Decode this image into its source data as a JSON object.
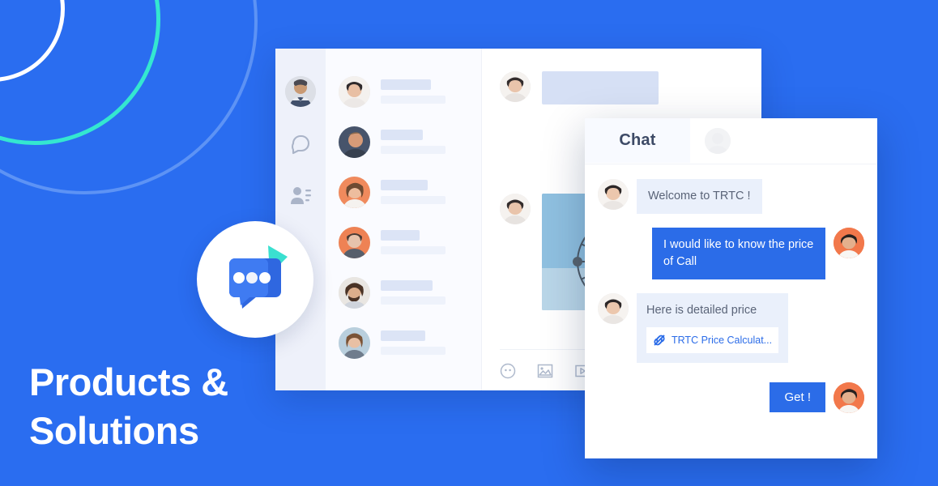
{
  "page": {
    "background_color": "#2a6df0",
    "accent_blue": "#2b6ce8",
    "accent_cyan": "#34e7d0",
    "bubble_grey": "#eaf0fb"
  },
  "hero": {
    "line1": "Products &",
    "line2": "Solutions"
  },
  "logo": {
    "name": "trtc-chat-logo",
    "dots": 3
  },
  "decor": {
    "arcs": [
      {
        "name": "arc-outer",
        "color": "#5d93f5"
      },
      {
        "name": "arc-mid",
        "color": "#34e7d0"
      },
      {
        "name": "arc-inner",
        "color": "#ffffff"
      }
    ]
  },
  "back_window": {
    "rail": {
      "avatar_label": "user-avatar",
      "items": [
        {
          "icon": "chat-bubble-icon",
          "label": "Chats"
        },
        {
          "icon": "contacts-icon",
          "label": "Contacts"
        }
      ]
    },
    "contact_list": {
      "items": [
        {
          "name": "contact-1",
          "title": "",
          "subtitle": ""
        },
        {
          "name": "contact-2",
          "title": "",
          "subtitle": ""
        },
        {
          "name": "contact-3",
          "title": "",
          "subtitle": ""
        },
        {
          "name": "contact-4",
          "title": "",
          "subtitle": ""
        },
        {
          "name": "contact-5",
          "title": "",
          "subtitle": ""
        },
        {
          "name": "contact-6",
          "title": "",
          "subtitle": ""
        }
      ]
    },
    "conversation": {
      "messages": [
        {
          "type": "placeholder",
          "name": "message-placeholder"
        },
        {
          "type": "image",
          "name": "message-photo",
          "alt": "ferris-wheel-photo"
        }
      ],
      "toolbar": [
        {
          "icon": "emoji-icon",
          "label": "Emoji"
        },
        {
          "icon": "image-icon",
          "label": "Image"
        },
        {
          "icon": "video-icon",
          "label": "Video"
        }
      ]
    }
  },
  "chat_panel": {
    "tab_label": "Chat",
    "header_avatar": "contact-avatar",
    "messages": [
      {
        "side": "left",
        "avatar": "agent-avatar",
        "text": "Welcome to TRTC !"
      },
      {
        "side": "right",
        "avatar": "user-avatar",
        "text": "I would like to know the price of Call"
      },
      {
        "side": "left",
        "avatar": "agent-avatar",
        "text": "Here is detailed price",
        "link": {
          "icon": "link-icon",
          "label": "TRTC Price Calculat..."
        }
      }
    ],
    "action": {
      "button_label": "Get !",
      "avatar": "user-avatar"
    }
  }
}
